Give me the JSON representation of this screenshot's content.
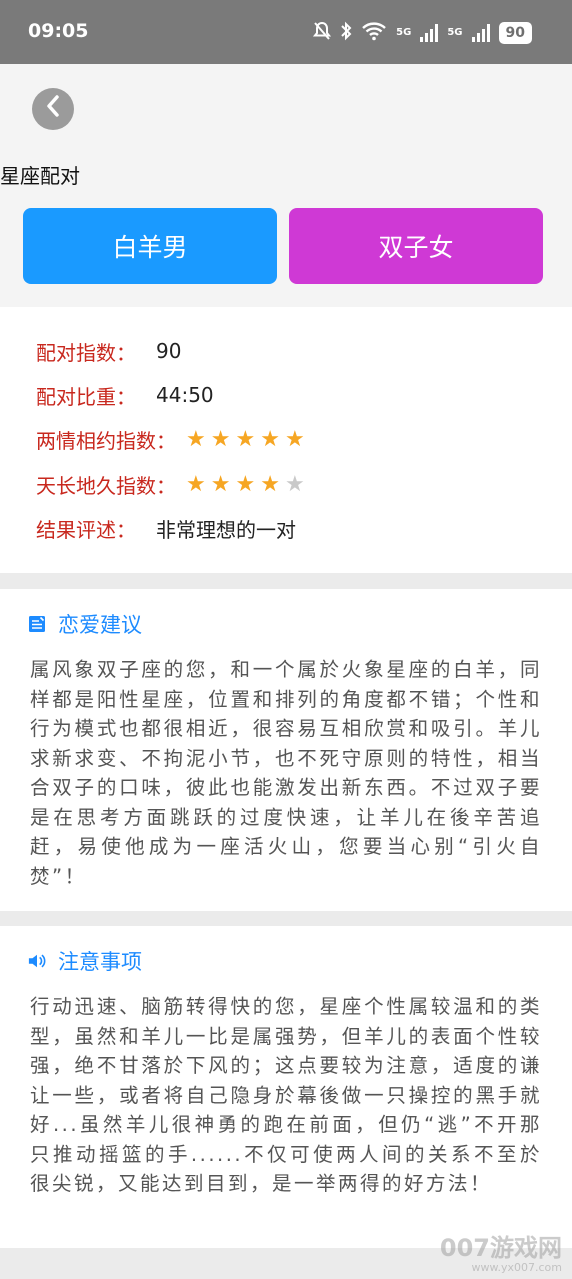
{
  "status_bar": {
    "time": "09:05",
    "net1": "5G",
    "net2": "5G",
    "battery": "90",
    "icons": [
      "bell-muted-icon",
      "bluetooth-icon",
      "wifi-icon",
      "signal-icon",
      "signal-icon",
      "battery-icon"
    ]
  },
  "header": {
    "back_icon": "chevron-left-icon",
    "title": "星座配对",
    "left_sign": "白羊男",
    "right_sign": "双子女",
    "colors": {
      "left": "#1a9aff",
      "right": "#cf39d5"
    }
  },
  "result": {
    "score_label": "配对指数：",
    "score_value": "90",
    "ratio_label": "配对比重：",
    "ratio_value": "44:50",
    "love_label": "两情相约指数：",
    "love_stars": 5,
    "lasting_label": "天长地久指数：",
    "lasting_stars": 4,
    "stars_max": 5,
    "summary_label": "结果评述：",
    "summary_value": "非常理想的一对",
    "label_color": "#c8281e",
    "star_color": "#f6a623"
  },
  "love_advice": {
    "icon": "note-edit-icon",
    "title": "恋爱建议",
    "text": "属风象双子座的您，和一个属於火象星座的白羊，同样都是阳性星座，位置和排列的角度都不错；个性和行为模式也都很相近，很容易互相欣赏和吸引。羊儿求新求变、不拘泥小节，也不死守原则的特性，相当合双子的口味，彼此也能激发出新东西。不过双子要是在思考方面跳跃的过度快速，让羊儿在後辛苦追赶，易使他成为一座活火山，您要当心别“引火自焚”！"
  },
  "notes": {
    "icon": "speaker-icon",
    "title": "注意事项",
    "text": "行动迅速、脑筋转得快的您，星座个性属较温和的类型，虽然和羊儿一比是属强势，但羊儿的表面个性较强，绝不甘落於下风的；这点要较为注意，适度的谦让一些，或者将自己隐身於幕後做一只操控的黑手就好...虽然羊儿很神勇的跑在前面，但仍“逃”不开那只推动摇篮的手......不仅可使两人间的关系不至於很尖锐，又能达到目到，是一举两得的好方法！"
  },
  "watermark": {
    "main": "007游戏网",
    "sub": "www.yx007.com"
  }
}
